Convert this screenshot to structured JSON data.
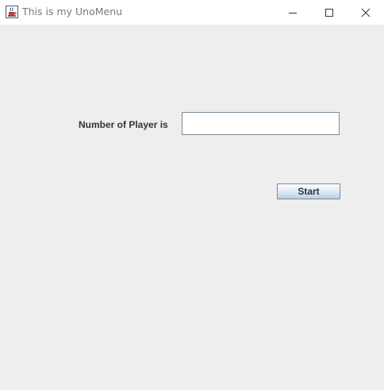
{
  "window": {
    "title": "This is my UnoMenu"
  },
  "form": {
    "players_label": "Number of Player is",
    "players_value": "",
    "start_label": "Start"
  },
  "icons": {
    "app": "java-cup-icon",
    "minimize": "minimize-icon",
    "maximize": "maximize-icon",
    "close": "close-icon"
  }
}
